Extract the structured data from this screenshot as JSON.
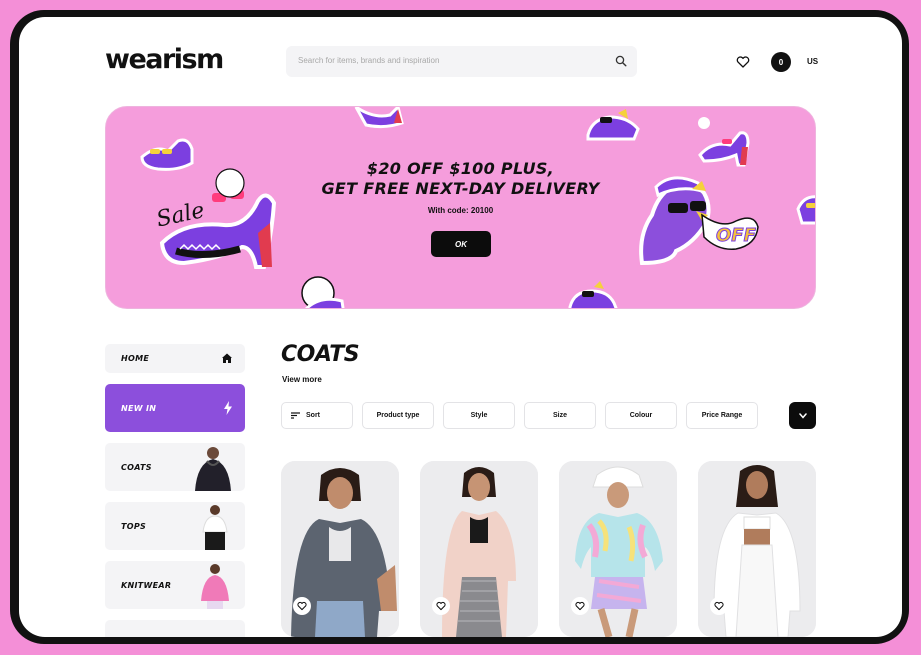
{
  "header": {
    "logo": "wearism",
    "search_placeholder": "Search for items, brands and inspiration",
    "cart_count": "0",
    "region": "US"
  },
  "banner": {
    "line1": "$20 OFF $100 PLUS,",
    "line2": "GET FREE NEXT-DAY DELIVERY",
    "code_text": "With code: 20100",
    "button_label": "OK",
    "sticker_text_sale": "Sale",
    "sticker_text_off": "OFF"
  },
  "sidebar": {
    "items": [
      {
        "label": "HOME",
        "icon": "home-icon"
      },
      {
        "label": "NEW IN",
        "icon": "lightning-icon"
      },
      {
        "label": "COATS",
        "icon": "coat-thumbnail"
      },
      {
        "label": "TOPS",
        "icon": "top-thumbnail"
      },
      {
        "label": "KNITWEAR",
        "icon": "knitwear-thumbnail"
      }
    ]
  },
  "main": {
    "title": "COATS",
    "view_more": "View more",
    "filters": [
      "Sort",
      "Product type",
      "Style",
      "Size",
      "Colour",
      "Price Range"
    ]
  },
  "products": [
    {
      "name": "grey denim jacket",
      "color": "#5c6470"
    },
    {
      "name": "pink teddy bomber",
      "color": "#f1d2c8"
    },
    {
      "name": "tie dye denim jacket",
      "color": "#b6e4ea"
    },
    {
      "name": "white blazer",
      "color": "#ffffff"
    }
  ],
  "colors": {
    "accent_purple": "#8c4fdc",
    "banner_pink": "#f59ddc",
    "page_pink": "#f48fd7"
  }
}
